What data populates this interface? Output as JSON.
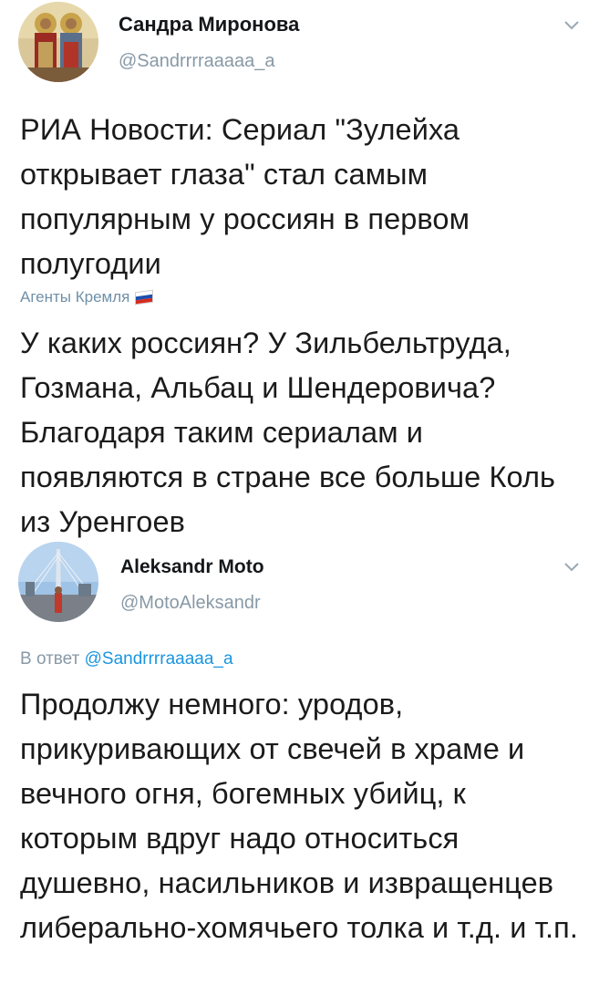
{
  "tweets": [
    {
      "author": {
        "name": "Сандра Миронова",
        "handle": "@Sandrrrraaaaa_a",
        "avatar_icon": "icon-painting-avatar-icon"
      },
      "menu_icon": "chevron-down-icon",
      "text": "РИА Новости: Сериал \"Зулейха открывает глаза\" стал самым популярным у россиян в первом полугодии",
      "card_caption": "Агенты Кремля",
      "card_flag": "russian-flag-icon",
      "comment": "У каких россиян? У Зильбельтруда, Гозмана, Альбац и Шендеровича? Благодаря таким сериалам и появляются в стране все больше Коль из Уренгоев"
    },
    {
      "author": {
        "name": "Aleksandr Moto",
        "handle": "@MotoAleksandr",
        "avatar_icon": "bridge-photo-avatar-icon"
      },
      "menu_icon": "chevron-down-icon",
      "reply_prefix": "В ответ",
      "reply_to": "@Sandrrrraaaaa_a",
      "text": "Продолжу немного: уродов, прикуривающих от свечей в храме и вечного огня, богемных убийц, к которым вдруг надо относиться душевно, насильников и извращенцев либерально-хомячьего толка и т.д. и т.п."
    }
  ],
  "colors": {
    "handle": "#8899a6",
    "link": "#1b95e0",
    "caption": "#6f90a8"
  }
}
